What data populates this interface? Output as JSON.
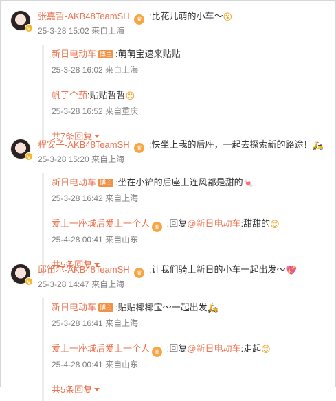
{
  "comments": [
    {
      "user": "张嘉哲-AKB48TeamSH",
      "sep": " :",
      "text": "比花儿萌的小车～",
      "emoji": "😮",
      "user_badge_icon": "crown-badge",
      "time": "25-3-28 15:02",
      "location": "来自上海",
      "replies": [
        {
          "user": "新日电动车",
          "brand_badge": "博主",
          "text": ":萌萌宝速来贴贴",
          "mention": "",
          "tail": "",
          "emoji": "",
          "time": "25-3-28 16:02",
          "location": "来自上海"
        },
        {
          "user": "帆了个茄",
          "brand_badge": "",
          "text": ":贴贴哲哲",
          "mention": "",
          "tail": "",
          "emoji": "😍",
          "time": "25-3-28 16:52",
          "location": "来自重庆"
        }
      ],
      "more": "共7条回复"
    },
    {
      "user": "程安子-AKB48TeamSH",
      "sep": " :",
      "text": "快坐上我的后座，一起去探索新的路途！",
      "emoji": "🛵",
      "user_badge_icon": "crown-badge",
      "time": "25-3-28 15:20",
      "location": "来自上海",
      "replies": [
        {
          "user": "新日电动车",
          "brand_badge": "博主",
          "text": ":坐在小铲的后座上连风都是甜的",
          "mention": "",
          "tail": "",
          "emoji": "🍬",
          "time": "25-3-28 16:42",
          "location": "来自上海"
        },
        {
          "user": "爱上一座城后爱上一个人",
          "brand_badge": "",
          "text": " :回复",
          "mention": "@新日电动车",
          "tail": ":甜甜的",
          "emoji": "😊",
          "time": "25-4-28 00:41",
          "location": "来自山东"
        }
      ],
      "more": "共5条回复"
    },
    {
      "user": "邱笛尔-AKB48TeamSH",
      "sep": " :",
      "text": "让我们骑上新日的小车一起出发～",
      "emoji": "💖",
      "user_badge_icon": "crown-badge",
      "time": "25-3-28 14:47",
      "location": "来自上海",
      "replies": [
        {
          "user": "新日电动车",
          "brand_badge": "博主",
          "text": ":贴贴椰椰宝～一起出发",
          "mention": "",
          "tail": "",
          "emoji": "🛵",
          "time": "25-3-28 16:41",
          "location": "来自上海"
        },
        {
          "user": "爱上一座城后爱上一个人",
          "brand_badge": "",
          "text": " :回复",
          "mention": "@新日电动车",
          "tail": ":走起",
          "emoji": "😊",
          "time": "25-4-28 00:41",
          "location": "来自山东"
        }
      ],
      "more": "共5条回复"
    }
  ]
}
